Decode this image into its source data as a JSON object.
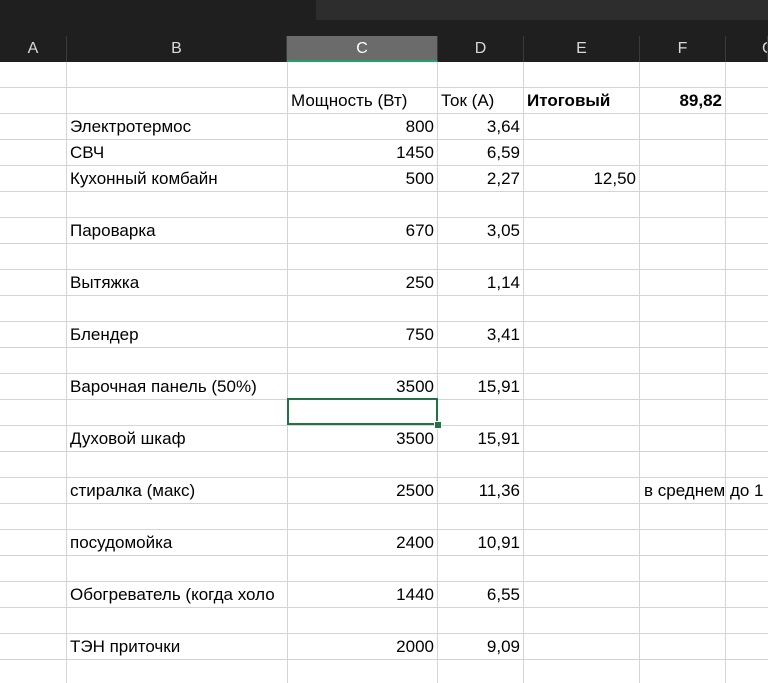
{
  "columns": [
    "A",
    "B",
    "C",
    "D",
    "E",
    "F",
    "G"
  ],
  "selected_column": "C",
  "header_row": {
    "power": "Мощность (Вт)",
    "current": "Ток (А)",
    "total_label": "Итоговый",
    "total_value": "89,82"
  },
  "rows": [
    {
      "name": "Электротермос",
      "power": "800",
      "current": "3,64"
    },
    {
      "name": "СВЧ",
      "power": "1450",
      "current": "6,59"
    },
    {
      "name": "Кухонный комбайн",
      "power": "500",
      "current": "2,27",
      "extra": "12,50"
    },
    {
      "name": "Пароварка",
      "power": "670",
      "current": "3,05"
    },
    {
      "name": "Вытяжка",
      "power": "250",
      "current": "1,14"
    },
    {
      "name": "Блендер",
      "power": "750",
      "current": "3,41"
    },
    {
      "name": "Варочная панель (50%)",
      "power": "3500",
      "current": "15,91"
    },
    {
      "name": "Духовой шкаф",
      "power": "3500",
      "current": "15,91"
    },
    {
      "name": "стиралка (макс)",
      "power": "2500",
      "current": "11,36",
      "note": "в среднем до 1"
    },
    {
      "name": "посудомойка",
      "power": "2400",
      "current": "10,91"
    },
    {
      "name": "Обогреватель (когда холо",
      "power": "1440",
      "current": "6,55"
    },
    {
      "name": "ТЭН приточки",
      "power": "2000",
      "current": "9,09"
    }
  ]
}
